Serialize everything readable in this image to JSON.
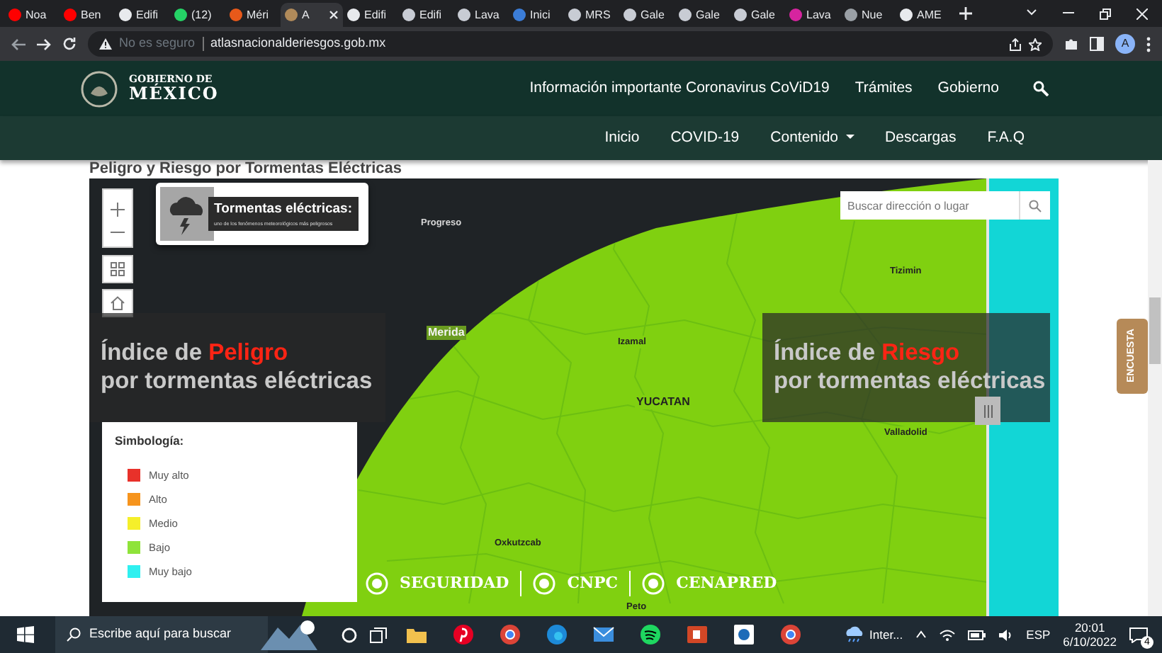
{
  "browser": {
    "tabs": [
      {
        "label": "Noa",
        "selected": false,
        "color": "#ff0000"
      },
      {
        "label": "Ben",
        "selected": false,
        "color": "#ff0000"
      },
      {
        "label": "Edifi",
        "selected": false,
        "color": "#e8eaed"
      },
      {
        "label": "(12)",
        "selected": false,
        "color": "#25d366"
      },
      {
        "label": "Méri",
        "selected": false,
        "color": "#e8591a"
      },
      {
        "label": "A",
        "selected": true,
        "color": "#b08a5a"
      },
      {
        "label": "Edifi",
        "selected": false,
        "color": "#e8eaed"
      },
      {
        "label": "Edifi",
        "selected": false,
        "color": "#c8ccd4"
      },
      {
        "label": "Lava",
        "selected": false,
        "color": "#c8ccd4"
      },
      {
        "label": "Inici",
        "selected": false,
        "color": "#3b7dd8"
      },
      {
        "label": "MRS",
        "selected": false,
        "color": "#c8ccd4"
      },
      {
        "label": "Gale",
        "selected": false,
        "color": "#c8ccd4"
      },
      {
        "label": "Gale",
        "selected": false,
        "color": "#c8ccd4"
      },
      {
        "label": "Gale",
        "selected": false,
        "color": "#c8ccd4"
      },
      {
        "label": "Lava",
        "selected": false,
        "color": "#d6249f"
      },
      {
        "label": "Nue",
        "selected": false,
        "color": "#9aa0a6"
      },
      {
        "label": "AME",
        "selected": false,
        "color": "#e8eaed"
      }
    ],
    "profile": "A",
    "security": "No es seguro",
    "url": "atlasnacionalderiesgos.gob.mx"
  },
  "site": {
    "logo": [
      "GOBIERNO DE",
      "MÉXICO"
    ],
    "top_links": [
      "Información importante Coronavirus CoViD19",
      "Trámites",
      "Gobierno"
    ],
    "nav": [
      {
        "label": "Inicio",
        "dropdown": false
      },
      {
        "label": "COVID-19",
        "dropdown": false
      },
      {
        "label": "Contenido",
        "dropdown": true
      },
      {
        "label": "Descargas",
        "dropdown": false
      },
      {
        "label": "F.A.Q",
        "dropdown": false
      }
    ]
  },
  "heading": "Peligro y Riesgo por Tormentas Eléctricas",
  "map": {
    "title_card": {
      "title": "Tormentas eléctricas:",
      "subtitle": "uno de los fenómenos meteorológicos más peligrosos"
    },
    "search": {
      "placeholder": "Buscar dirección o lugar"
    },
    "panels": [
      {
        "prefix": "Índice de",
        "highlight": "Peligro",
        "line2": "por tormentas eléctricas"
      },
      {
        "prefix": "Índice de",
        "highlight": "Riesgo",
        "line2": "por tormentas eléctricas"
      }
    ],
    "place_labels": [
      "Progreso",
      "Merida",
      "Izamal",
      "YUCATAN",
      "Tizimin",
      "Valladolid",
      "Oxkutzcab",
      "Peto"
    ],
    "legend": {
      "title": "Simbología:",
      "items": [
        {
          "label": "Muy alto",
          "color": "#e8312a"
        },
        {
          "label": "Alto",
          "color": "#f6941d"
        },
        {
          "label": "Medio",
          "color": "#f5ef2a"
        },
        {
          "label": "Bajo",
          "color": "#8fe33a"
        },
        {
          "label": "Muy bajo",
          "color": "#2ff0f0"
        }
      ]
    },
    "logos": [
      "SEGURIDAD",
      "CNPC",
      "CENAPRED"
    ]
  },
  "survey_tab": "ENCUESTA",
  "taskbar": {
    "search": "Escribe aquí para buscar",
    "weather": "Inter...",
    "language": "ESP",
    "time": "20:01",
    "date": "6/10/2022",
    "notifications": "4"
  }
}
